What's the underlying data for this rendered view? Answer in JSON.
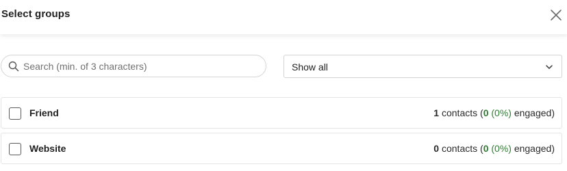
{
  "dialog": {
    "title": "Select groups"
  },
  "search": {
    "placeholder": "Search (min. of 3 characters)",
    "value": ""
  },
  "filter": {
    "selected": "Show all"
  },
  "groups": [
    {
      "name": "Friend",
      "contact_count": "1",
      "contacts_word": " contacts (",
      "engaged_count": "0",
      "engaged_pct": " (0%)",
      "engaged_word": " engaged)",
      "checked": false
    },
    {
      "name": "Website",
      "contact_count": "0",
      "contacts_word": " contacts (",
      "engaged_count": "0",
      "engaged_pct": " (0%)",
      "engaged_word": " engaged)",
      "checked": false
    }
  ],
  "icons": {
    "close": "close-icon",
    "search": "search-icon",
    "dropdown": "chevron-down-icon"
  },
  "colors": {
    "engaged_green": "#2e7d32",
    "border": "#d4d4d4"
  }
}
